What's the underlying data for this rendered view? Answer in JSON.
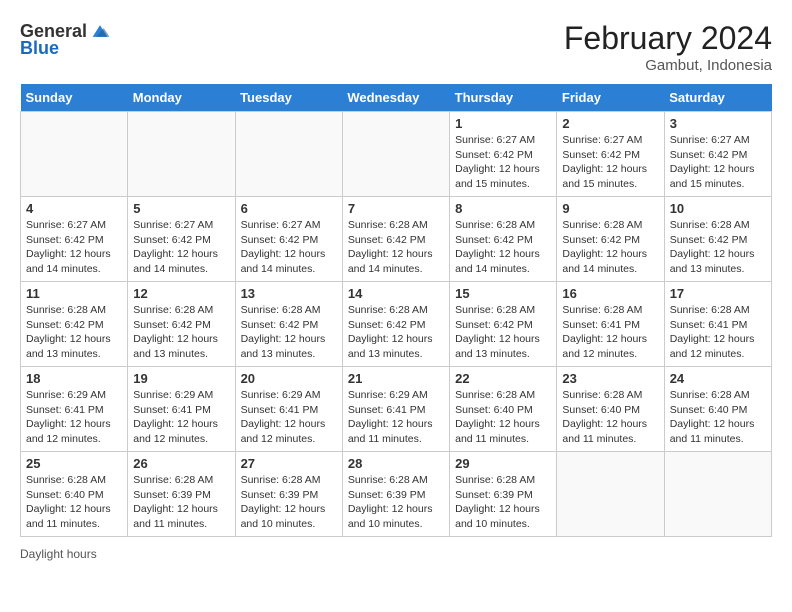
{
  "header": {
    "logo_general": "General",
    "logo_blue": "Blue",
    "title": "February 2024",
    "location": "Gambut, Indonesia"
  },
  "days_of_week": [
    "Sunday",
    "Monday",
    "Tuesday",
    "Wednesday",
    "Thursday",
    "Friday",
    "Saturday"
  ],
  "weeks": [
    [
      {
        "num": "",
        "info": ""
      },
      {
        "num": "",
        "info": ""
      },
      {
        "num": "",
        "info": ""
      },
      {
        "num": "",
        "info": ""
      },
      {
        "num": "1",
        "info": "Sunrise: 6:27 AM\nSunset: 6:42 PM\nDaylight: 12 hours and 15 minutes."
      },
      {
        "num": "2",
        "info": "Sunrise: 6:27 AM\nSunset: 6:42 PM\nDaylight: 12 hours and 15 minutes."
      },
      {
        "num": "3",
        "info": "Sunrise: 6:27 AM\nSunset: 6:42 PM\nDaylight: 12 hours and 15 minutes."
      }
    ],
    [
      {
        "num": "4",
        "info": "Sunrise: 6:27 AM\nSunset: 6:42 PM\nDaylight: 12 hours and 14 minutes."
      },
      {
        "num": "5",
        "info": "Sunrise: 6:27 AM\nSunset: 6:42 PM\nDaylight: 12 hours and 14 minutes."
      },
      {
        "num": "6",
        "info": "Sunrise: 6:27 AM\nSunset: 6:42 PM\nDaylight: 12 hours and 14 minutes."
      },
      {
        "num": "7",
        "info": "Sunrise: 6:28 AM\nSunset: 6:42 PM\nDaylight: 12 hours and 14 minutes."
      },
      {
        "num": "8",
        "info": "Sunrise: 6:28 AM\nSunset: 6:42 PM\nDaylight: 12 hours and 14 minutes."
      },
      {
        "num": "9",
        "info": "Sunrise: 6:28 AM\nSunset: 6:42 PM\nDaylight: 12 hours and 14 minutes."
      },
      {
        "num": "10",
        "info": "Sunrise: 6:28 AM\nSunset: 6:42 PM\nDaylight: 12 hours and 13 minutes."
      }
    ],
    [
      {
        "num": "11",
        "info": "Sunrise: 6:28 AM\nSunset: 6:42 PM\nDaylight: 12 hours and 13 minutes."
      },
      {
        "num": "12",
        "info": "Sunrise: 6:28 AM\nSunset: 6:42 PM\nDaylight: 12 hours and 13 minutes."
      },
      {
        "num": "13",
        "info": "Sunrise: 6:28 AM\nSunset: 6:42 PM\nDaylight: 12 hours and 13 minutes."
      },
      {
        "num": "14",
        "info": "Sunrise: 6:28 AM\nSunset: 6:42 PM\nDaylight: 12 hours and 13 minutes."
      },
      {
        "num": "15",
        "info": "Sunrise: 6:28 AM\nSunset: 6:42 PM\nDaylight: 12 hours and 13 minutes."
      },
      {
        "num": "16",
        "info": "Sunrise: 6:28 AM\nSunset: 6:41 PM\nDaylight: 12 hours and 12 minutes."
      },
      {
        "num": "17",
        "info": "Sunrise: 6:28 AM\nSunset: 6:41 PM\nDaylight: 12 hours and 12 minutes."
      }
    ],
    [
      {
        "num": "18",
        "info": "Sunrise: 6:29 AM\nSunset: 6:41 PM\nDaylight: 12 hours and 12 minutes."
      },
      {
        "num": "19",
        "info": "Sunrise: 6:29 AM\nSunset: 6:41 PM\nDaylight: 12 hours and 12 minutes."
      },
      {
        "num": "20",
        "info": "Sunrise: 6:29 AM\nSunset: 6:41 PM\nDaylight: 12 hours and 12 minutes."
      },
      {
        "num": "21",
        "info": "Sunrise: 6:29 AM\nSunset: 6:41 PM\nDaylight: 12 hours and 11 minutes."
      },
      {
        "num": "22",
        "info": "Sunrise: 6:28 AM\nSunset: 6:40 PM\nDaylight: 12 hours and 11 minutes."
      },
      {
        "num": "23",
        "info": "Sunrise: 6:28 AM\nSunset: 6:40 PM\nDaylight: 12 hours and 11 minutes."
      },
      {
        "num": "24",
        "info": "Sunrise: 6:28 AM\nSunset: 6:40 PM\nDaylight: 12 hours and 11 minutes."
      }
    ],
    [
      {
        "num": "25",
        "info": "Sunrise: 6:28 AM\nSunset: 6:40 PM\nDaylight: 12 hours and 11 minutes."
      },
      {
        "num": "26",
        "info": "Sunrise: 6:28 AM\nSunset: 6:39 PM\nDaylight: 12 hours and 11 minutes."
      },
      {
        "num": "27",
        "info": "Sunrise: 6:28 AM\nSunset: 6:39 PM\nDaylight: 12 hours and 10 minutes."
      },
      {
        "num": "28",
        "info": "Sunrise: 6:28 AM\nSunset: 6:39 PM\nDaylight: 12 hours and 10 minutes."
      },
      {
        "num": "29",
        "info": "Sunrise: 6:28 AM\nSunset: 6:39 PM\nDaylight: 12 hours and 10 minutes."
      },
      {
        "num": "",
        "info": ""
      },
      {
        "num": "",
        "info": ""
      }
    ]
  ],
  "footer": {
    "daylight_label": "Daylight hours"
  }
}
